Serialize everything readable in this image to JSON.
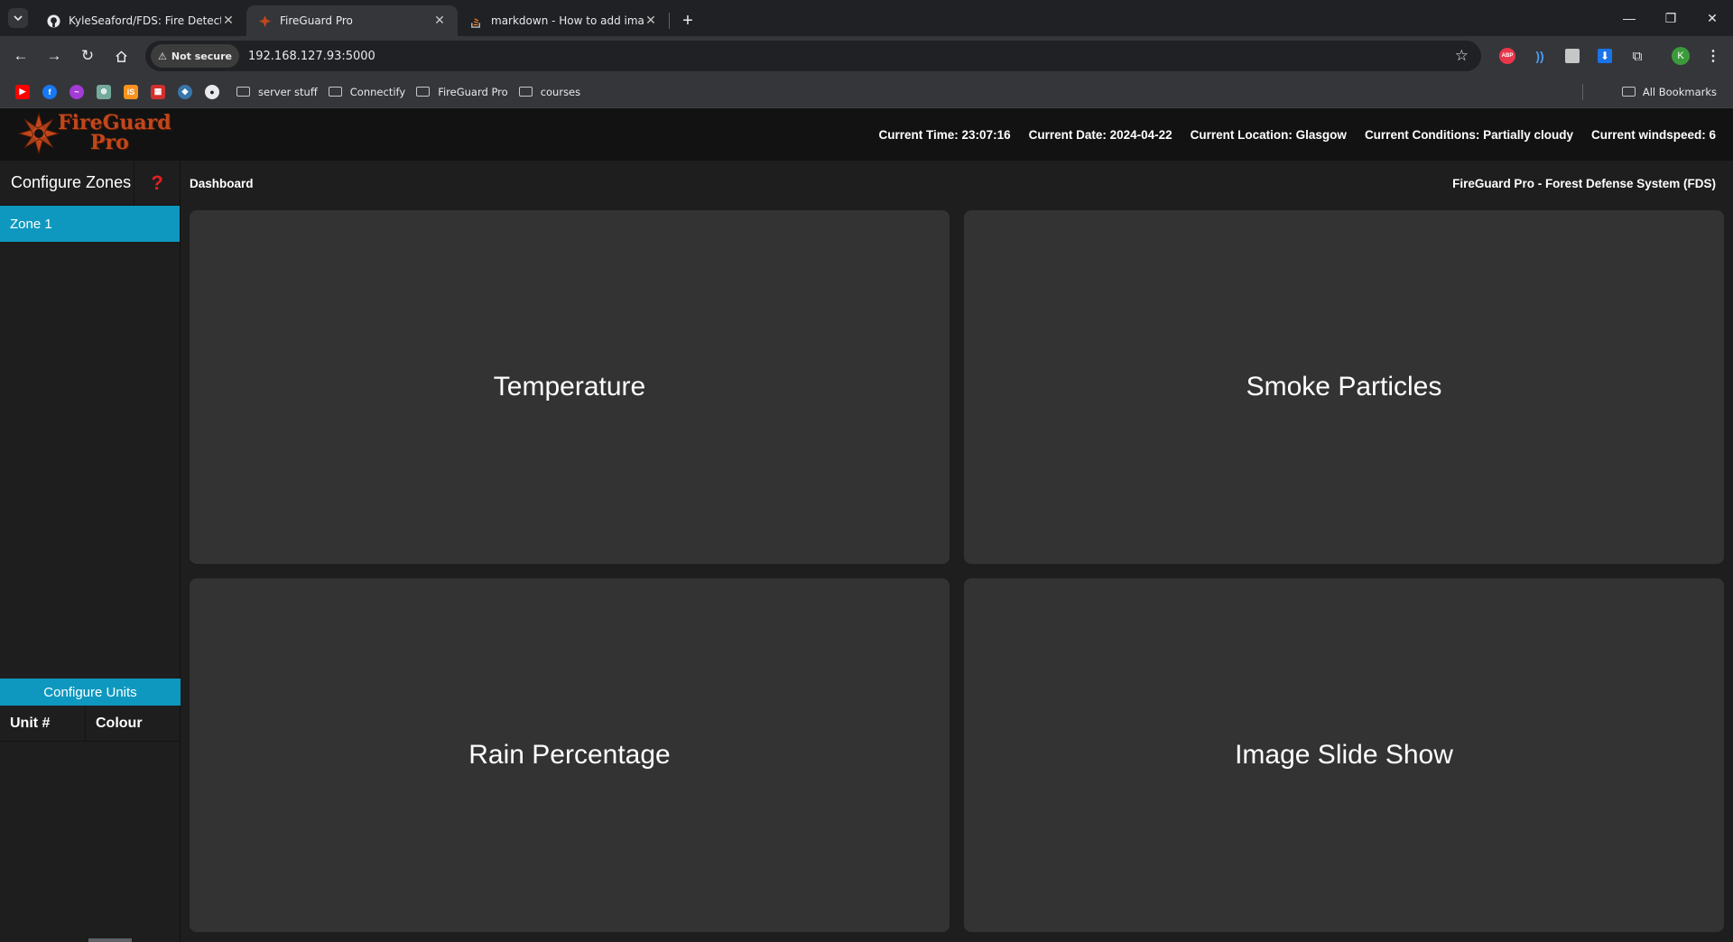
{
  "browser": {
    "tabs": [
      {
        "title": "KyleSeaford/FDS: Fire Detectio",
        "icon": "github-icon",
        "active": false
      },
      {
        "title": "FireGuard Pro",
        "icon": "fireguard-icon",
        "active": true
      },
      {
        "title": "markdown - How to add imag",
        "icon": "stackoverflow-icon",
        "active": false
      }
    ],
    "security_label": "Not secure",
    "url": "192.168.127.93:5000",
    "bookmark_folders": [
      "server stuff",
      "Connectify",
      "FireGuard Pro",
      "courses"
    ],
    "all_bookmarks": "All Bookmarks",
    "profile_initial": "K",
    "abp_label": "ABP"
  },
  "app": {
    "logo": {
      "line1": "FireGuard",
      "line2": "Pro"
    },
    "info": {
      "time": "Current Time: 23:07:16",
      "date": "Current Date: 2024-04-22",
      "location": "Current Location: Glasgow",
      "conditions": "Current Conditions: Partially cloudy",
      "windspeed": "Current windspeed: 6"
    },
    "sidebar": {
      "configure_zones": "Configure Zones",
      "help": "?",
      "zones": [
        "Zone 1"
      ],
      "configure_units": "Configure Units",
      "units_columns": [
        "Unit #",
        "Colour"
      ]
    },
    "breadcrumb": "Dashboard",
    "system_title": "FireGuard Pro - Forest Defense System (FDS)",
    "panels": [
      "Temperature",
      "Smoke Particles",
      "Rain Percentage",
      "Image Slide Show"
    ]
  },
  "colors": {
    "accent": "#0e98bf",
    "logo": "#c0471c",
    "panel": "#333333"
  }
}
